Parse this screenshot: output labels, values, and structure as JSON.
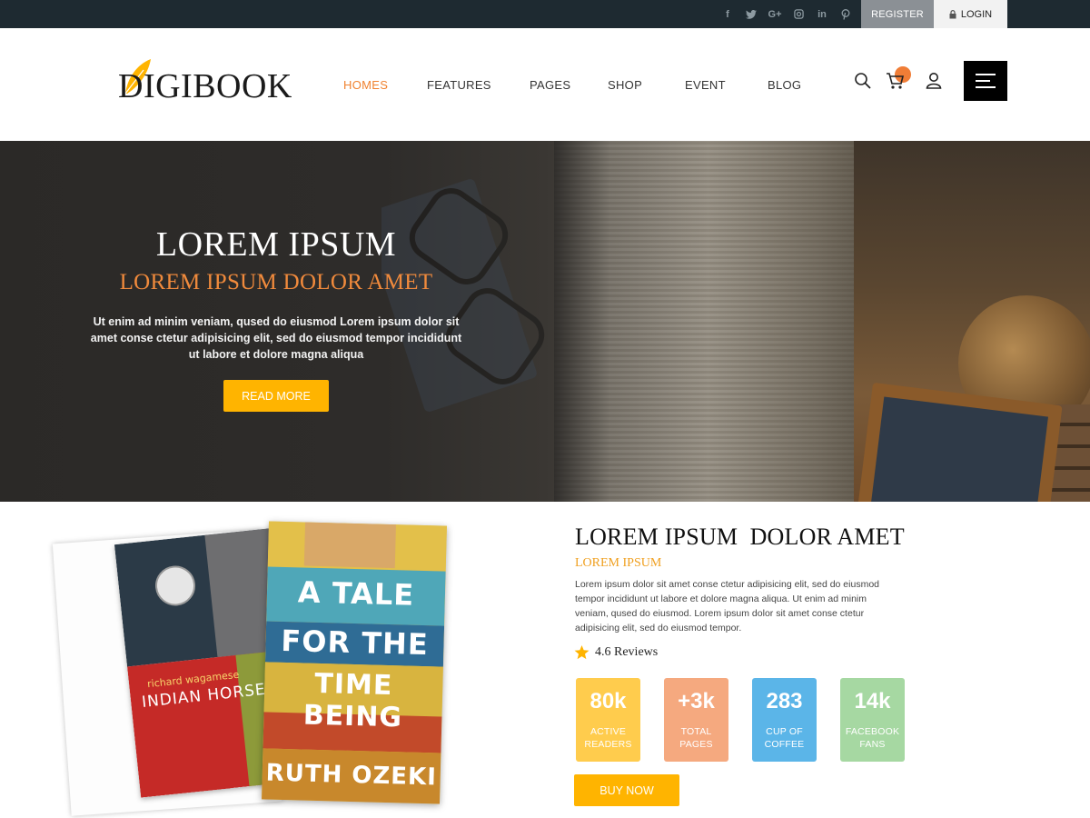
{
  "topbar": {
    "social": [
      {
        "icon": "facebook-icon",
        "glyph": "f"
      },
      {
        "icon": "twitter-icon",
        "glyph": "t"
      },
      {
        "icon": "google-plus-icon",
        "glyph": "G+"
      },
      {
        "icon": "instagram-icon",
        "glyph": ""
      },
      {
        "icon": "linkedin-icon",
        "glyph": "in"
      },
      {
        "icon": "pinterest-icon",
        "glyph": "p"
      }
    ],
    "register_label": "REGISTER",
    "login_label": "LOGIN"
  },
  "header": {
    "logo_text": "DIGIBOOK",
    "nav": [
      {
        "label": "HOMES",
        "active": true
      },
      {
        "label": "FEATURES",
        "active": false
      },
      {
        "label": "PAGES",
        "active": false
      },
      {
        "label": "SHOP",
        "active": false
      },
      {
        "label": "EVENT",
        "active": false
      },
      {
        "label": "BLOG",
        "active": false
      }
    ]
  },
  "hero": {
    "title": "LOREM IPSUM",
    "subtitle": "LOREM IPSUM DOLOR AMET",
    "text": "Ut enim ad minim veniam, qused do eiusmod  Lorem ipsum dolor sit amet conse ctetur adipisicing elit, sed do eiusmod tempor incididunt ut labore et dolore magna aliqua",
    "button_label": "READ MORE"
  },
  "product": {
    "cover_left_author": "richard wagamese",
    "cover_left_title": "INDIAN HORSE",
    "cover_right_lines": [
      "A TALE",
      "FOR THE",
      "TIME BEING"
    ],
    "cover_right_author": "RUTH OZEKI",
    "title": "LOREM IPSUM  DOLOR AMET",
    "subtitle": "LOREM IPSUM",
    "description": "Lorem ipsum dolor sit amet conse ctetur adipisicing elit, sed do eiusmod tempor incididunt ut labore et dolore magna aliqua. Ut enim ad minim veniam, qused do eiusmod. Lorem ipsum dolor sit amet conse ctetur adipisicing elit, sed do eiusmod tempor.",
    "rating_text": "4.6 Reviews",
    "stats": [
      {
        "value": "80k",
        "line1": "ACTIVE",
        "line2": "READERS",
        "color": "#ffcc4d"
      },
      {
        "value": "+3k",
        "line1": "TOTAL",
        "line2": "PAGES",
        "color": "#f5a97f"
      },
      {
        "value": "283",
        "line1": "CUP OF",
        "line2": "COFFEE",
        "color": "#5bb5e8"
      },
      {
        "value": "14k",
        "line1": "FACEBOOK",
        "line2": "FANS",
        "color": "#a6d8a2"
      }
    ],
    "buy_label": "BUY NOW"
  },
  "colors": {
    "accent": "#f08230",
    "button": "#ffb400",
    "topbar": "#1e2a31"
  }
}
